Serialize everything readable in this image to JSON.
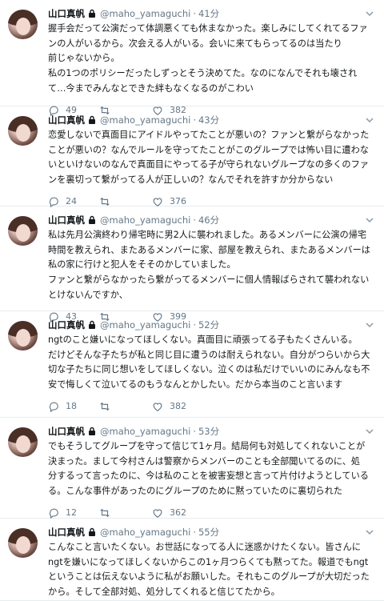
{
  "tweets": [
    {
      "name": "山口真帆",
      "handle": "@maho_yamaguchi",
      "time": "41分",
      "lines": [
        "握手会だって公演だって体調悪くても休まなかった。楽しみにしてくれてるファ",
        "ンの人がいるから。次会える人がいる。会いに来てもらってるのは当たり",
        "前じゃないから。",
        "私の1つのポリシーだったしずっとそう決めてた。なのになんでそれも壊され",
        "て…今までみんなとできた絆もなくなるのがこわい"
      ],
      "replies": "49",
      "retweets": "",
      "likes": "382"
    },
    {
      "name": "山口真帆",
      "handle": "@maho_yamaguchi",
      "time": "43分",
      "lines": [
        "恋愛しないで真面目にアイドルやってたことが悪いの？ファンと繋がらなかった",
        "ことが悪いの？なんでルールを守ってたことがこのグループでは怖い目に遭わな",
        "いといけないのなんで真面目にやってる子が守られないグループなの多くのファ",
        "ンを裏切って繋がってる人が正しいの？なんでそれを許すか分からない"
      ],
      "replies": "24",
      "retweets": "",
      "likes": "376"
    },
    {
      "name": "山口真帆",
      "handle": "@maho_yamaguchi",
      "time": "46分",
      "lines": [
        "私は先月公演終わり帰宅時に男2人に襲われました。あるメンバーに公演の帰宅",
        "時間を教えられ、またあるメンバーに家、部屋を教えられ、またあるメンバーは",
        "私の家に行けと犯人をそそのかしていました。",
        "ファンと繋がらなかったら繋がってるメンバーに個人情報ばらされて襲われない",
        "とけないんですか、"
      ],
      "replies": "43",
      "retweets": "",
      "likes": "399"
    },
    {
      "name": "山口真帆",
      "handle": "@maho_yamaguchi",
      "time": "52分",
      "lines": [
        "ngtのこと嫌いになってほしくない。真面目に頑張ってる子もたくさんいる。",
        "だけどそんな子たちが私と同じ目に遭うのは耐えられない。自分がつらいから大",
        "切な子たちに同じ想いをしてほしくない。泣くのは私だけでいいのにみんなも不",
        "安で悔しくて泣いてるのもうなんとかしたい。だから本当のこと言います"
      ],
      "replies": "18",
      "retweets": "",
      "likes": "382"
    },
    {
      "name": "山口真帆",
      "handle": "@maho_yamaguchi",
      "time": "53分",
      "lines": [
        "でもそうしてグループを守って信じて1ヶ月。結局何も対処してくれないことが",
        "決まった。まして今村さんは警察からメンバーのことも全部聞いてるのに、処",
        "分するって言ったのに、今は私のことを被害妄想と言って片付けようとしている",
        "る。こんな事件があったのにグループのために黙っていたのに裏切られた"
      ],
      "replies": "12",
      "retweets": "",
      "likes": "362"
    },
    {
      "name": "山口真帆",
      "handle": "@maho_yamaguchi",
      "time": "55分",
      "lines": [
        "こんなこと言いたくない。お世話になってる人に迷惑かけたくない。皆さんに",
        "ngtを嫌いになってほしくないからこの1ヶ月つらくても黙ってた。報道でもngt",
        "ということは伝えないように私がお願いした。それもこのグループが大切だった",
        "から。そして全部対処、処分してくれると信じてたから。"
      ],
      "replies": "",
      "retweets": "",
      "likes": ""
    }
  ]
}
